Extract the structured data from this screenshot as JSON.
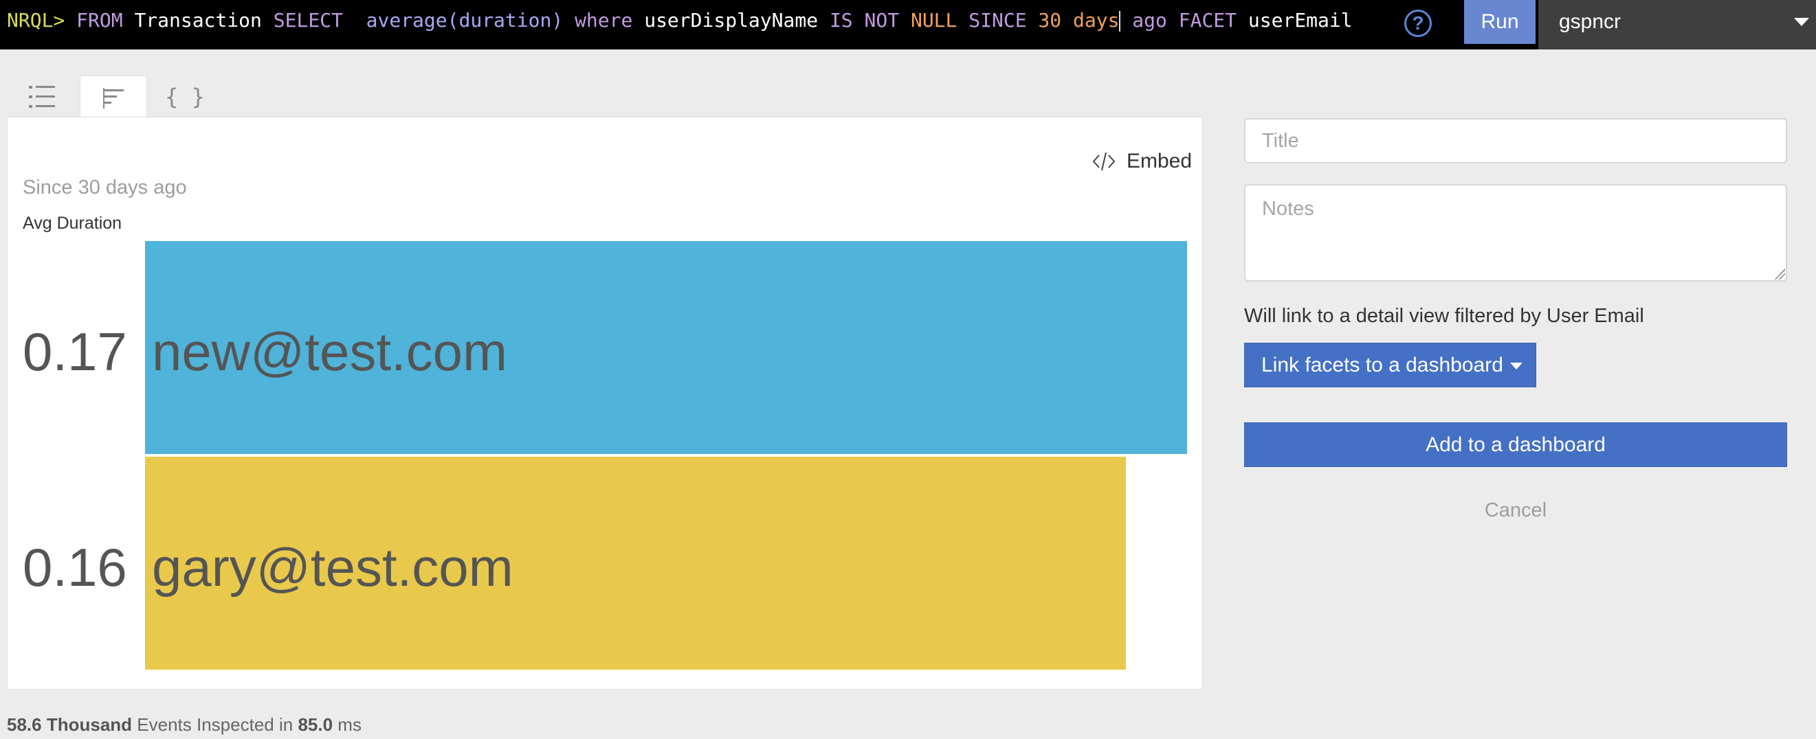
{
  "query": {
    "prompt": "NRQL>",
    "from_kw": "FROM",
    "event_type": "Transaction",
    "select_kw": "SELECT",
    "function": "average(duration)",
    "where_kw": "where",
    "attribute": "userDisplayName",
    "is_kw": "IS",
    "not_kw": "NOT",
    "null_kw": "NULL",
    "since_kw": "SINCE",
    "since_num": "30",
    "since_unit": "days",
    "ago_kw": "ago",
    "facet_kw": "FACET",
    "facet_attr": "userEmail"
  },
  "help_icon": "question-circle-icon",
  "run_label": "Run",
  "account": "gspncr",
  "tabs": {
    "list_icon": "list-icon",
    "bars_icon": "bar-chart-icon",
    "json_label": "{ }"
  },
  "chart_panel": {
    "embed_label": "Embed",
    "since_text": "Since 30 days ago",
    "series_label": "Avg Duration"
  },
  "chart_data": {
    "type": "bar",
    "orientation": "horizontal",
    "categories": [
      "new@test.com",
      "gary@test.com"
    ],
    "values": [
      0.17,
      0.16
    ],
    "value_labels": [
      "0.17",
      "0.16"
    ],
    "colors": [
      "#4fb3da",
      "#e8c94b"
    ],
    "ylabel": "Avg Duration",
    "subtitle": "Since 30 days ago",
    "xlim": [
      0,
      0.17
    ]
  },
  "footer": {
    "count": "58.6 Thousand",
    "events_text": "Events Inspected in",
    "time": "85.0",
    "unit": "ms"
  },
  "form": {
    "title_placeholder": "Title",
    "notes_placeholder": "Notes",
    "link_info": "Will link to a detail view filtered by User Email",
    "link_facets_label": "Link facets to a dashboard",
    "add_label": "Add to a dashboard",
    "cancel_label": "Cancel"
  }
}
